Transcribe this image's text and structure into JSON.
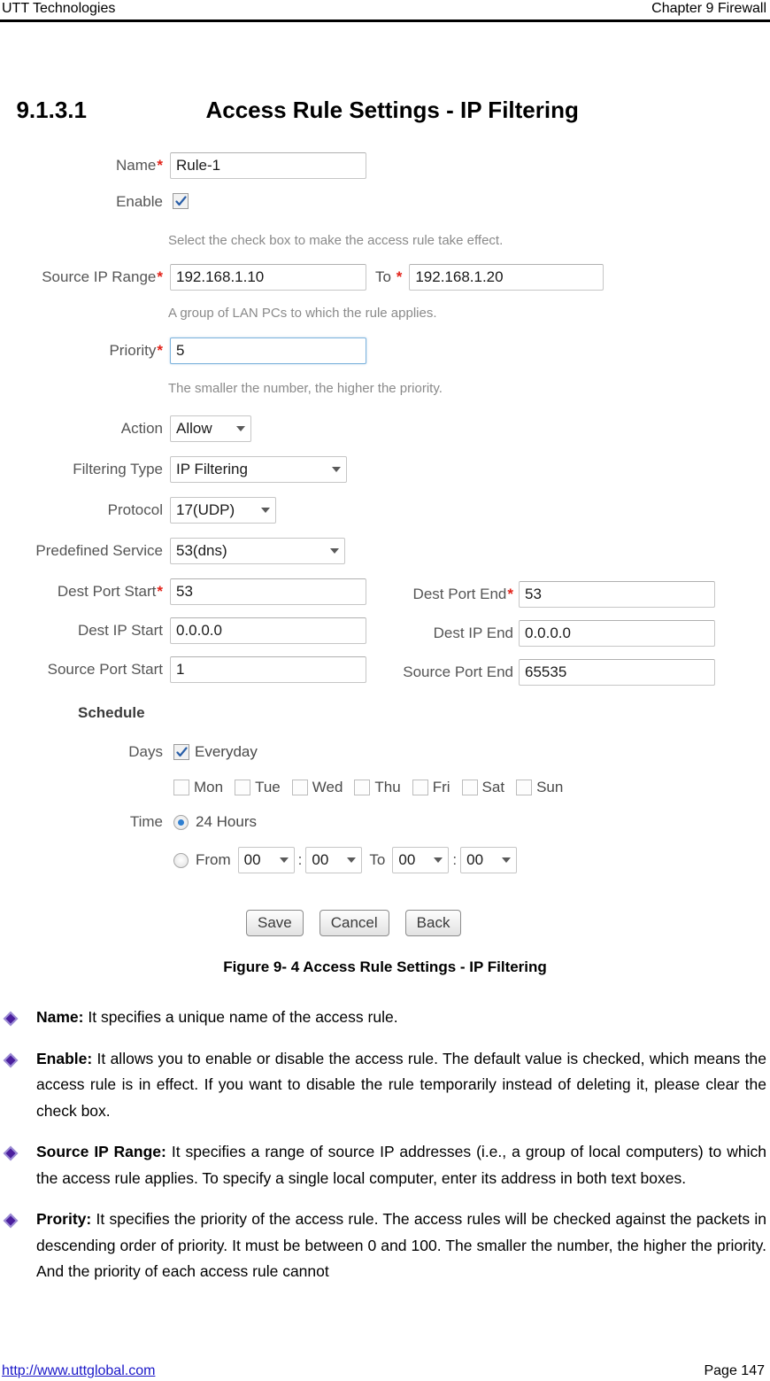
{
  "header": {
    "left": "UTT Technologies",
    "right": "Chapter 9 Firewall"
  },
  "heading": {
    "number": "9.1.3.1",
    "title": "Access Rule Settings - IP Filtering"
  },
  "form": {
    "name": {
      "label": "Name",
      "required": "*",
      "value": "Rule-1"
    },
    "enable": {
      "label": "Enable",
      "checked": true,
      "hint": "Select the check box to make the access rule take effect."
    },
    "source_ip_range": {
      "label": "Source IP Range",
      "required": "*",
      "start": "192.168.1.10",
      "to_label": "To",
      "to_required": "*",
      "end": "192.168.1.20",
      "hint": "A group of LAN PCs to which the rule applies."
    },
    "priority": {
      "label": "Priority",
      "required": "*",
      "value": "5",
      "hint": "The smaller the number, the higher the priority."
    },
    "action": {
      "label": "Action",
      "value": "Allow"
    },
    "filtering_type": {
      "label": "Filtering Type",
      "value": "IP Filtering"
    },
    "protocol": {
      "label": "Protocol",
      "value": "17(UDP)"
    },
    "predefined_service": {
      "label": "Predefined Service",
      "value": "53(dns)"
    },
    "dest_port_start": {
      "label": "Dest Port Start",
      "required": "*",
      "value": "53"
    },
    "dest_port_end": {
      "label": "Dest Port End",
      "required": "*",
      "value": "53"
    },
    "dest_ip_start": {
      "label": "Dest IP Start",
      "value": "0.0.0.0"
    },
    "dest_ip_end": {
      "label": "Dest IP End",
      "value": "0.0.0.0"
    },
    "source_port_start": {
      "label": "Source Port Start",
      "value": "1"
    },
    "source_port_end": {
      "label": "Source Port End",
      "value": "65535"
    },
    "schedule": {
      "title": "Schedule",
      "days_label": "Days",
      "everyday_label": "Everyday",
      "everyday_checked": true,
      "weekdays": [
        {
          "label": "Mon",
          "checked": false
        },
        {
          "label": "Tue",
          "checked": false
        },
        {
          "label": "Wed",
          "checked": false
        },
        {
          "label": "Thu",
          "checked": false
        },
        {
          "label": "Fri",
          "checked": false
        },
        {
          "label": "Sat",
          "checked": false
        },
        {
          "label": "Sun",
          "checked": false
        }
      ],
      "time_label": "Time",
      "option_24h_label": "24 Hours",
      "option_24h_selected": true,
      "from_label": "From",
      "from_hour": "00",
      "from_minute": "00",
      "to_label": "To",
      "to_hour": "00",
      "to_minute": "00",
      "colon": ":",
      "option_range_selected": false
    },
    "buttons": {
      "save": "Save",
      "cancel": "Cancel",
      "back": "Back"
    }
  },
  "figure_caption": "Figure 9- 4 Access Rule Settings - IP Filtering",
  "bullets": [
    {
      "term": "Name:",
      "text": " It specifies a unique name of the access rule."
    },
    {
      "term": "Enable:",
      "text": " It allows you to enable or disable the access rule. The default value is checked, which means the access rule is in effect. If you want to disable the rule temporarily instead of deleting it, please clear the check box."
    },
    {
      "term": "Source IP Range:",
      "text": " It specifies a range of source IP addresses (i.e., a group of local computers) to which the access rule applies. To specify a single local computer, enter its address in both text boxes."
    },
    {
      "term": "Prority:",
      "text": " It specifies the priority of the access rule. The access rules will be checked against the packets in descending order of priority. It must be between 0 and 100. The smaller the number, the higher the priority. And the priority of each access rule cannot"
    }
  ],
  "footer": {
    "link": "http://www.uttglobal.com",
    "page": "Page 147"
  },
  "colors": {
    "required_star": "#e2231a",
    "bullet_diamond": "#5b2d91",
    "link": "#1a17c8",
    "focus_border": "#7eb4dd"
  }
}
